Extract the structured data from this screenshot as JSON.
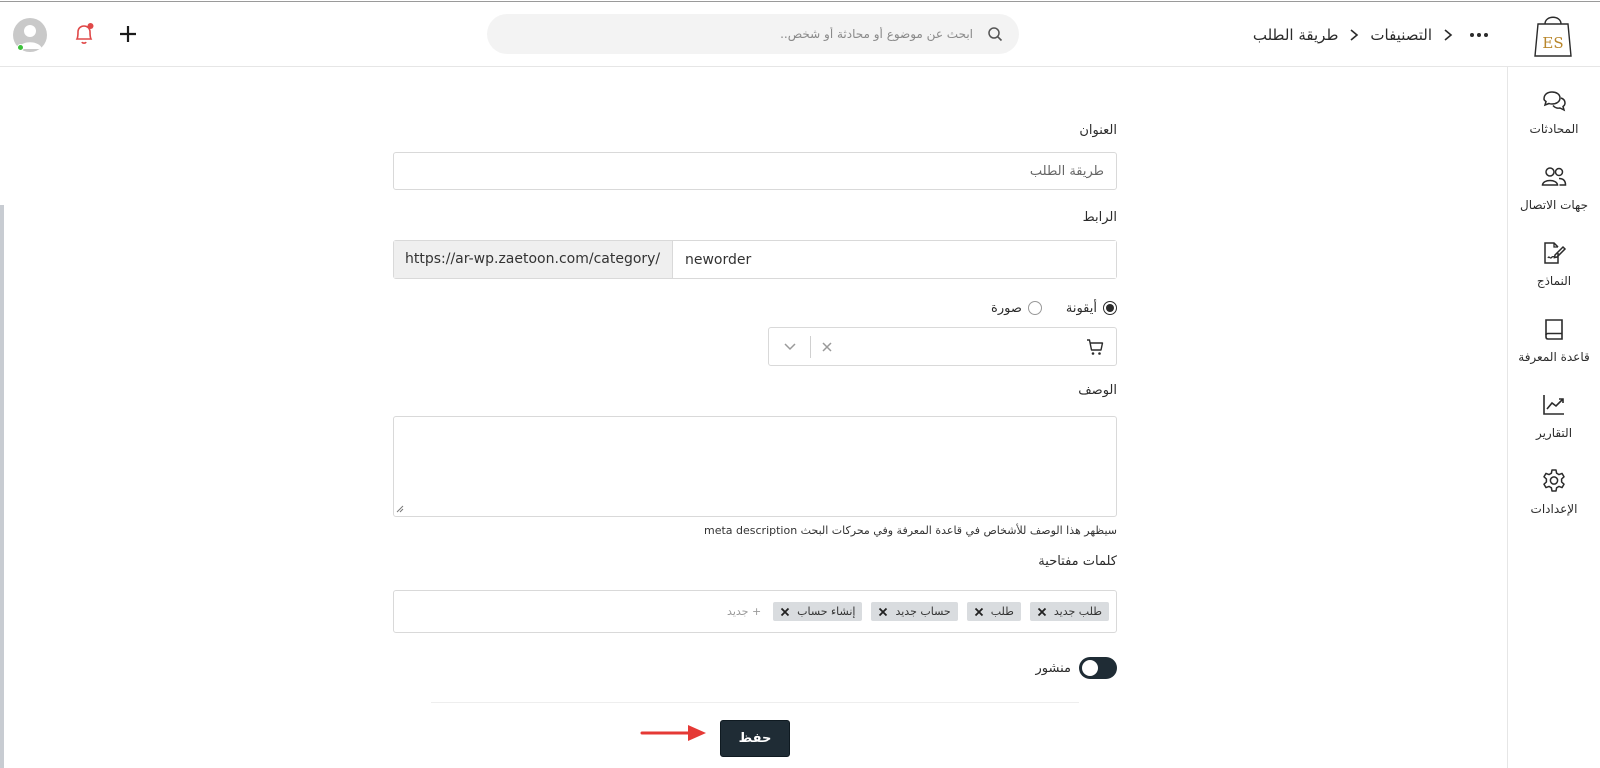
{
  "header": {
    "breadcrumb": {
      "parent": "التصنيفات",
      "current": "طريقة الطلب"
    },
    "search_placeholder": "ابحث عن موضوع أو محادثة أو شخص..",
    "logo_text": "ES"
  },
  "sidebar": {
    "items": [
      {
        "label": "المحادثات",
        "icon": "chat-icon"
      },
      {
        "label": "جهات الاتصال",
        "icon": "contacts-icon"
      },
      {
        "label": "النماذج",
        "icon": "forms-icon"
      },
      {
        "label": "قاعدة المعرفة",
        "icon": "book-icon"
      },
      {
        "label": "التقارير",
        "icon": "chart-icon"
      },
      {
        "label": "الإعدادات",
        "icon": "gear-icon"
      }
    ]
  },
  "form": {
    "title_label": "العنوان",
    "title_value": "طريقة الطلب",
    "link_label": "الرابط",
    "link_prefix": "https://ar-wp.zaetoon.com/category/",
    "link_slug": "neworder",
    "media_options": {
      "icon": "أيقونة",
      "image": "صورة",
      "selected": "icon"
    },
    "selected_icon": "cart-icon",
    "description_label": "الوصف",
    "description_value": "",
    "description_help": "سيظهر هذا الوصف للأشخاص في قاعدة المعرفة وفي محركات البحث meta description",
    "keywords_label": "كلمات مفتاحية",
    "keywords": [
      "طلب جديد",
      "طلب",
      "حساب جديد",
      "إنشاء حساب"
    ],
    "add_keyword": "+ جديد",
    "published_label": "منشور",
    "published": true,
    "save_label": "حفظ"
  },
  "colors": {
    "primary_dark": "#1f2c35",
    "notification": "#e04848",
    "online": "#3cc13b",
    "arrow": "#e53935"
  }
}
